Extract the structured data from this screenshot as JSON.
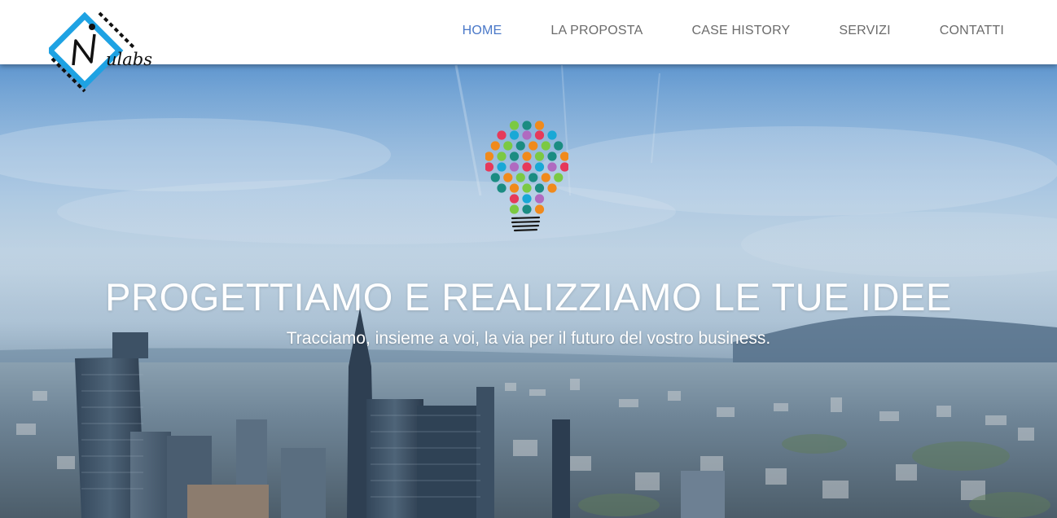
{
  "header": {
    "logo": {
      "text": "ulabs",
      "icon": "nulabs-logo-icon",
      "colors": {
        "primary": "#1ea2e3",
        "ink": "#111111"
      }
    },
    "nav": {
      "items": [
        {
          "label": "HOME",
          "active": true
        },
        {
          "label": "LA PROPOSTA",
          "active": false
        },
        {
          "label": "CASE HISTORY",
          "active": false
        },
        {
          "label": "SERVIZI",
          "active": false
        },
        {
          "label": "CONTATTI",
          "active": false
        }
      ],
      "colors": {
        "active": "#4a78c8",
        "default": "#6b6b6b"
      }
    }
  },
  "hero": {
    "icon": "lightbulb-icon",
    "title": "PROGETTIAMO E REALIZZIAMO LE TUE IDEE",
    "subtitle": "Tracciamo, insieme a voi, la via per il futuro del vostro business.",
    "background": "city-skyline-photo"
  }
}
